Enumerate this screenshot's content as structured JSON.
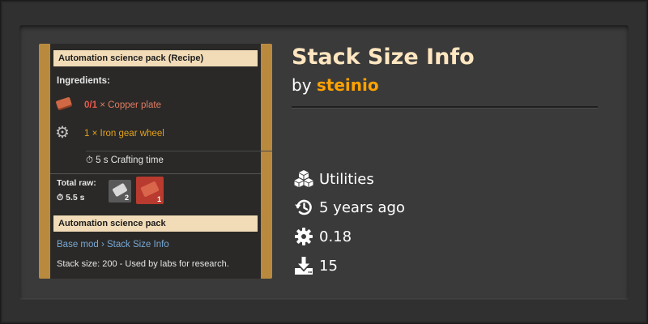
{
  "mod": {
    "title": "Stack Size Info",
    "by_prefix": "by",
    "author": "steinio",
    "category": "Utilities",
    "updated": "5 years ago",
    "version": "0.18",
    "downloads": "15"
  },
  "thumbnail": {
    "recipe_header": "Automation science pack (Recipe)",
    "ingredients_title": "Ingredients:",
    "ingredient1_count": "0/1",
    "ingredient1_name": "× Copper plate",
    "ingredient2_name": "1 × Iron gear wheel",
    "crafting_time": "5 s Crafting time",
    "total_raw_title": "Total raw:",
    "total_raw_time": "5.5 s",
    "raw_slot1_count": "2",
    "raw_slot2_count": "1",
    "item_header": "Automation science pack",
    "breadcrumb": "Base mod › Stack Size Info",
    "stack_size_line": "Stack size: 200 - Used by labs for research."
  },
  "colors": {
    "title": "#ffe6c0",
    "author": "#ffa200",
    "text": "#ffffff"
  },
  "icons": [
    "cubes-icon",
    "history-icon",
    "gear-icon",
    "download-icon"
  ]
}
